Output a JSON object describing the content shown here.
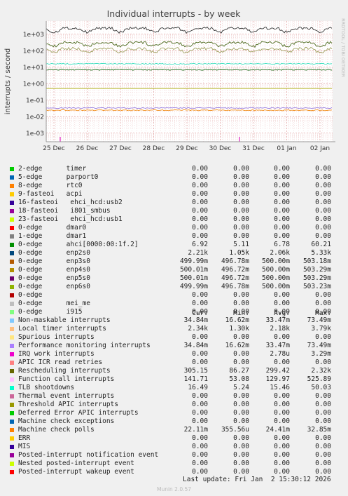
{
  "chart_data": {
    "type": "line",
    "title": "Individual interrupts - by week",
    "ylabel": "interrupts / second",
    "yscale": "log",
    "ylim": [
      0.0003,
      6000
    ],
    "yticks": [
      "1e+03",
      "1e+02",
      "1e+01",
      "1e+00",
      "1e-01",
      "1e-02",
      "1e-03"
    ],
    "xticks": [
      "25 Dec",
      "26 Dec",
      "27 Dec",
      "28 Dec",
      "29 Dec",
      "30 Dec",
      "31 Dec",
      "01 Jan",
      "02 Jan"
    ],
    "side_text": "RRDTOOL / TOBI OETIKER",
    "grid": true,
    "series": [
      {
        "name": "Local timer interrupts",
        "approx_level": 2180,
        "color": "#333333"
      },
      {
        "name": "Rescheduling interrupts",
        "approx_level": 299,
        "color": "#4d6b1f"
      },
      {
        "name": "Function call interrupts",
        "approx_level": 130,
        "color": "#a0a060"
      },
      {
        "name": "TLB shootdowns",
        "approx_level": 15.46,
        "color": "#3ce0c0"
      },
      {
        "name": "ahci[0000:00:1f.2]",
        "approx_level": 6.78,
        "color": "#1e6e1e"
      },
      {
        "name": "enp2s0 group",
        "approx_level": 0.5,
        "color": "#a6a600"
      },
      {
        "name": "Non-maskable / Performance monitoring",
        "approx_level": 0.033,
        "color": "#9a80e0"
      },
      {
        "name": "Machine check polls",
        "approx_level": 0.024,
        "color": "#f08c1c"
      },
      {
        "name": "IRQ work interrupts",
        "approx_level": 2.78e-06,
        "color": "#e020c0"
      }
    ]
  },
  "legend": {
    "headers": [
      "Cur:",
      "Min:",
      "Avg:",
      "Max:"
    ],
    "rows": [
      {
        "label": "2-edge      timer",
        "color": "#00cc00",
        "cur": "0.00",
        "min": "0.00",
        "avg": "0.00",
        "max": "0.00"
      },
      {
        "label": "5-edge      parport0",
        "color": "#0066b3",
        "cur": "0.00",
        "min": "0.00",
        "avg": "0.00",
        "max": "0.00"
      },
      {
        "label": "8-edge      rtc0",
        "color": "#ff8000",
        "cur": "0.00",
        "min": "0.00",
        "avg": "0.00",
        "max": "0.00"
      },
      {
        "label": "9-fasteoi   acpi",
        "color": "#ffcc00",
        "cur": "0.00",
        "min": "0.00",
        "avg": "0.00",
        "max": "0.00"
      },
      {
        "label": "16-fasteoi   ehci_hcd:usb2",
        "color": "#330099",
        "cur": "0.00",
        "min": "0.00",
        "avg": "0.00",
        "max": "0.00"
      },
      {
        "label": "18-fasteoi   i801_smbus",
        "color": "#990099",
        "cur": "0.00",
        "min": "0.00",
        "avg": "0.00",
        "max": "0.00"
      },
      {
        "label": "23-fasteoi   ehci_hcd:usb1",
        "color": "#ccff00",
        "cur": "0.00",
        "min": "0.00",
        "avg": "0.00",
        "max": "0.00"
      },
      {
        "label": "0-edge      dmar0",
        "color": "#ff0000",
        "cur": "0.00",
        "min": "0.00",
        "avg": "0.00",
        "max": "0.00"
      },
      {
        "label": "1-edge      dmar1",
        "color": "#808080",
        "cur": "0.00",
        "min": "0.00",
        "avg": "0.00",
        "max": "0.00"
      },
      {
        "label": "0-edge      ahci[0000:00:1f.2]",
        "color": "#008f00",
        "cur": "6.92",
        "min": "5.11",
        "avg": "6.78",
        "max": "60.21"
      },
      {
        "label": "0-edge      enp2s0",
        "color": "#00487d",
        "cur": "2.21k",
        "min": "1.05k",
        "avg": "2.06k",
        "max": "5.33k"
      },
      {
        "label": "0-edge      enp3s0",
        "color": "#b35a00",
        "cur": "499.99m",
        "min": "496.78m",
        "avg": "500.00m",
        "max": "503.18m"
      },
      {
        "label": "0-edge      enp4s0",
        "color": "#b38f00",
        "cur": "500.01m",
        "min": "496.72m",
        "avg": "500.00m",
        "max": "503.29m"
      },
      {
        "label": "0-edge      enp5s0",
        "color": "#6b006b",
        "cur": "500.01m",
        "min": "496.72m",
        "avg": "500.00m",
        "max": "503.29m"
      },
      {
        "label": "0-edge      enp6s0",
        "color": "#8fb300",
        "cur": "499.99m",
        "min": "496.78m",
        "avg": "500.00m",
        "max": "503.23m"
      },
      {
        "label": "0-edge",
        "color": "#b30000",
        "cur": "0.00",
        "min": "0.00",
        "avg": "0.00",
        "max": "0.00"
      },
      {
        "label": "0-edge      mei_me",
        "color": "#bebebe",
        "cur": "0.00",
        "min": "0.00",
        "avg": "0.00",
        "max": "0.00"
      },
      {
        "label": "0-edge      i915",
        "color": "#80ff80",
        "cur": "0.00",
        "min": "0.00",
        "avg": "0.00",
        "max": "0.00"
      },
      {
        "label": "Non-maskable interrupts",
        "color": "#80c9ff",
        "cur": "34.84m",
        "min": "16.62m",
        "avg": "33.47m",
        "max": "73.49m"
      },
      {
        "label": "Local timer interrupts",
        "color": "#ffc080",
        "cur": "2.34k",
        "min": "1.30k",
        "avg": "2.18k",
        "max": "3.79k"
      },
      {
        "label": "Spurious interrupts",
        "color": "#ffe680",
        "cur": "0.00",
        "min": "0.00",
        "avg": "0.00",
        "max": "0.00"
      },
      {
        "label": "Performance monitoring interrupts",
        "color": "#aa80ff",
        "cur": "34.84m",
        "min": "16.62m",
        "avg": "33.47m",
        "max": "73.49m"
      },
      {
        "label": "IRQ work interrupts",
        "color": "#ee00cc",
        "cur": "0.00",
        "min": "0.00",
        "avg": "2.78u",
        "max": "3.29m"
      },
      {
        "label": "APIC ICR read retries",
        "color": "#ff8080",
        "cur": "0.00",
        "min": "0.00",
        "avg": "0.00",
        "max": "0.00"
      },
      {
        "label": "Rescheduling interrupts",
        "color": "#666600",
        "cur": "305.15",
        "min": "86.27",
        "avg": "299.42",
        "max": "2.32k"
      },
      {
        "label": "Function call interrupts",
        "color": "#ffbfff",
        "cur": "141.71",
        "min": "53.08",
        "avg": "129.97",
        "max": "525.89"
      },
      {
        "label": "TLB shootdowns",
        "color": "#00ffcc",
        "cur": "16.49",
        "min": "5.24",
        "avg": "15.46",
        "max": "50.03"
      },
      {
        "label": "Thermal event interrupts",
        "color": "#cc6699",
        "cur": "0.00",
        "min": "0.00",
        "avg": "0.00",
        "max": "0.00"
      },
      {
        "label": "Threshold APIC interrupts",
        "color": "#999900",
        "cur": "0.00",
        "min": "0.00",
        "avg": "0.00",
        "max": "0.00"
      },
      {
        "label": "Deferred Error APIC interrupts",
        "color": "#00cc00",
        "cur": "0.00",
        "min": "0.00",
        "avg": "0.00",
        "max": "0.00"
      },
      {
        "label": "Machine check exceptions",
        "color": "#0066b3",
        "cur": "0.00",
        "min": "0.00",
        "avg": "0.00",
        "max": "0.00"
      },
      {
        "label": "Machine check polls",
        "color": "#ff8000",
        "cur": "22.11m",
        "min": "355.56u",
        "avg": "24.41m",
        "max": "32.85m"
      },
      {
        "label": "ERR",
        "color": "#ffcc00",
        "cur": "0.00",
        "min": "0.00",
        "avg": "0.00",
        "max": "0.00"
      },
      {
        "label": "MIS",
        "color": "#330099",
        "cur": "0.00",
        "min": "0.00",
        "avg": "0.00",
        "max": "0.00"
      },
      {
        "label": "Posted-interrupt notification event",
        "color": "#990099",
        "cur": "0.00",
        "min": "0.00",
        "avg": "0.00",
        "max": "0.00"
      },
      {
        "label": "Nested posted-interrupt event",
        "color": "#ccff00",
        "cur": "0.00",
        "min": "0.00",
        "avg": "0.00",
        "max": "0.00"
      },
      {
        "label": "Posted-interrupt wakeup event",
        "color": "#ff0000",
        "cur": "0.00",
        "min": "0.00",
        "avg": "0.00",
        "max": "0.00"
      }
    ]
  },
  "footer": {
    "last_update": "Last update: Fri Jan  2 15:30:12 2026",
    "generator": "Munin 2.0.57"
  }
}
